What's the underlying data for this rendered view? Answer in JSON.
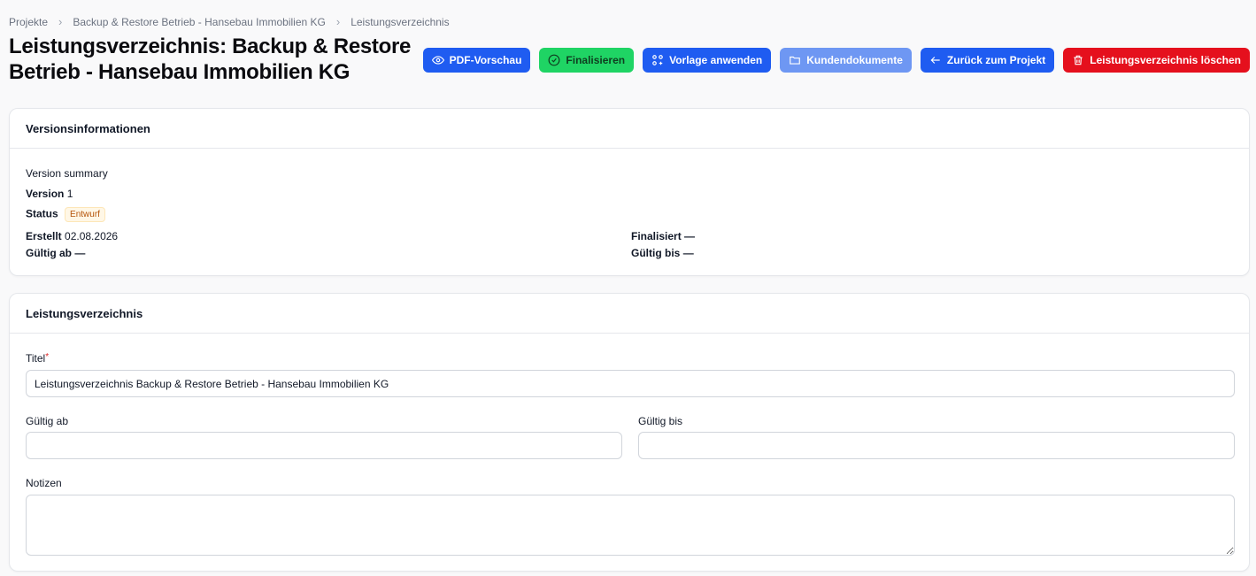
{
  "breadcrumb": {
    "items": [
      "Projekte",
      "Backup & Restore Betrieb - Hansebau Immobilien KG",
      "Leistungsverzeichnis"
    ]
  },
  "page": {
    "title": "Leistungsverzeichnis: Backup & Restore Betrieb - Hansebau Immobilien KG"
  },
  "toolbar": {
    "pdf_preview": "PDF-Vorschau",
    "finalize": "Finalisieren",
    "apply_template": "Vorlage anwenden",
    "customer_docs": "Kundendokumente",
    "back_to_project": "Zurück zum Projekt",
    "delete": "Leistungsverzeichnis löschen"
  },
  "version_card": {
    "title": "Versionsinformationen",
    "summary": "Version summary",
    "version_label": "Version",
    "version_value": "1",
    "status_label": "Status",
    "status_value": "Entwurf",
    "created_label": "Erstellt",
    "created_value": "02.08.2026",
    "finalized_label": "Finalisiert",
    "finalized_value": "—",
    "valid_from_label": "Gültig ab",
    "valid_from_value": "—",
    "valid_to_label": "Gültig bis",
    "valid_to_value": "—"
  },
  "form_card": {
    "title": "Leistungsverzeichnis",
    "title_label": "Titel",
    "required_mark": "*",
    "title_value": "Leistungsverzeichnis Backup & Restore Betrieb - Hansebau Immobilien KG",
    "valid_from_label": "Gültig ab",
    "valid_from_value": "",
    "valid_to_label": "Gültig bis",
    "valid_to_value": "",
    "notes_label": "Notizen",
    "notes_value": ""
  },
  "colors": {
    "primary": "#1f5cf1",
    "success": "#1fd464",
    "primary_light": "#6e97f3",
    "danger": "#e5101d",
    "badge_text": "#b45309"
  },
  "icons": [
    "eye-icon",
    "check-circle-icon",
    "template-icon",
    "folder-icon",
    "arrow-left-icon",
    "trash-icon",
    "chevron-right-icon"
  ]
}
